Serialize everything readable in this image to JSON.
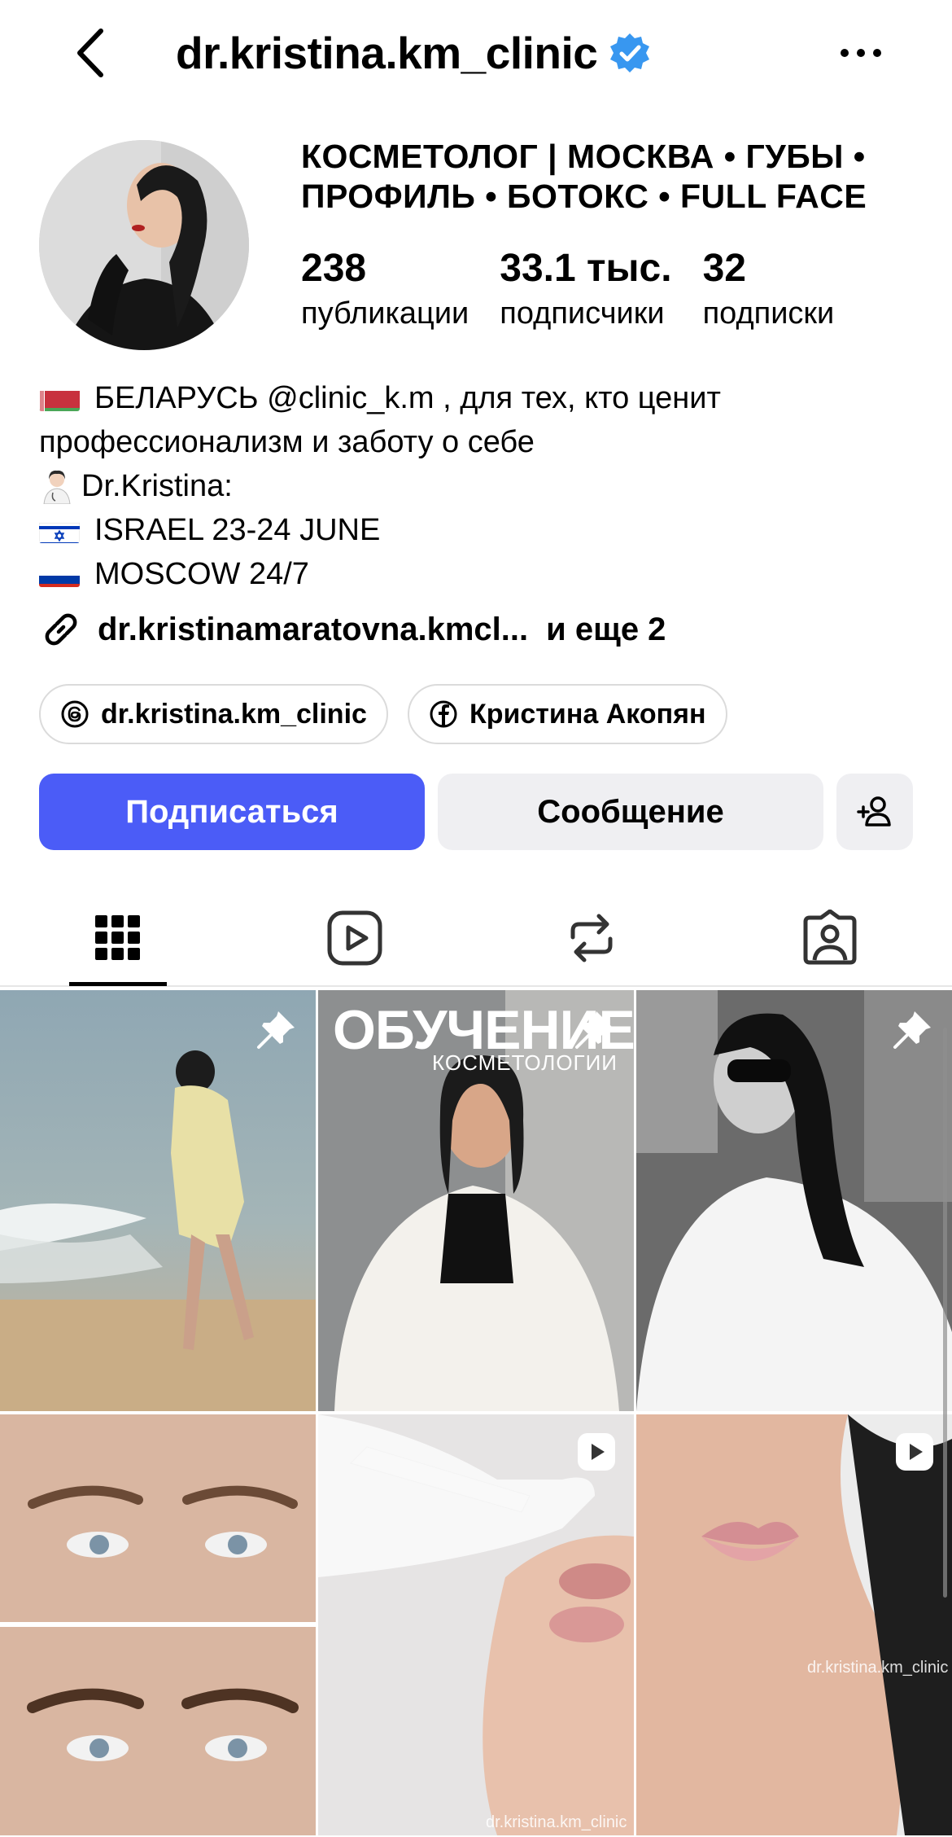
{
  "header": {
    "username": "dr.kristina.km_clinic",
    "verified": true
  },
  "profile": {
    "category": "КОСМЕТОЛОГ | МОСКВА • ГУБЫ • ПРОФИЛЬ • БОТОКС • FULL FACE",
    "stats": [
      {
        "value": "238",
        "label": "публикации"
      },
      {
        "value": "33.1 тыс.",
        "label": "подписчики"
      },
      {
        "value": "32",
        "label": "подписки"
      }
    ],
    "bio": {
      "line1": "БЕЛАРУСЬ @clinic_k.m , для тех, кто ценит",
      "line2": "профессионализм и заботу о себе",
      "line3": "Dr.Kristina:",
      "line4": "ISRAEL 23-24 JUNE",
      "line5": "MOSCOW 24/7"
    },
    "link": {
      "text": "dr.kristinamaratovna.kmcl...",
      "more": "и еще 2"
    },
    "chips": [
      {
        "icon": "threads-icon",
        "label": "dr.kristina.km_clinic"
      },
      {
        "icon": "facebook-icon",
        "label": "Кристина Акопян"
      }
    ]
  },
  "actions": {
    "follow": "Подписаться",
    "message": "Сообщение"
  },
  "tabs": [
    "grid-icon",
    "reels-icon",
    "reposts-icon",
    "tagged-icon"
  ],
  "grid": {
    "post2_title": "ОБУЧЕНИЕ",
    "post2_subtitle": "КОСМЕТОЛОГИИ",
    "watermark": "dr.kristina.km_clinic"
  },
  "colors": {
    "accent": "#4b5cf7",
    "verified": "#3897f0",
    "secondary_button": "#efeff2"
  }
}
